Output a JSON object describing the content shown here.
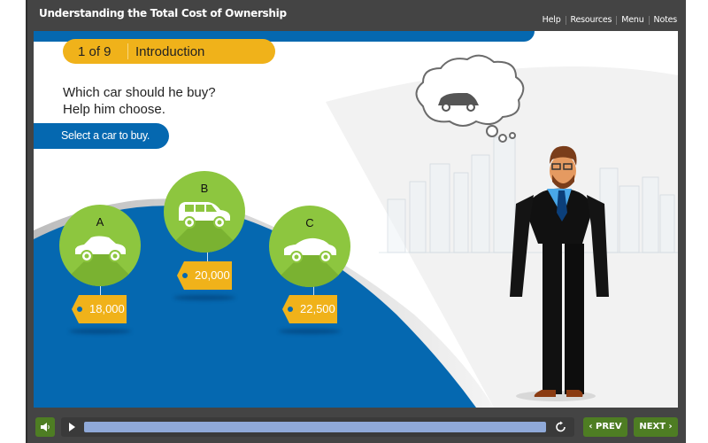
{
  "window": {
    "title": "Understanding the Total Cost of Ownership"
  },
  "top_links": [
    {
      "label": "Help"
    },
    {
      "label": "Resources"
    },
    {
      "label": "Menu"
    },
    {
      "label": "Notes"
    }
  ],
  "slide": {
    "progress_label": "1 of 9",
    "section": "Introduction",
    "question_line1": "Which car should he buy?",
    "question_line2": "Help him choose.",
    "instruction": "Select a car to buy.",
    "thought_bubble_icon": "suv-car-icon",
    "character": "businessman-illustration",
    "cars": [
      {
        "letter": "A",
        "type": "sedan",
        "icon": "sedan-car-icon",
        "price": "18,000"
      },
      {
        "letter": "B",
        "type": "suv",
        "icon": "suv-car-icon",
        "price": "20,000"
      },
      {
        "letter": "C",
        "type": "coupe",
        "icon": "coupe-car-icon",
        "price": "22,500"
      }
    ]
  },
  "controls": {
    "audio_icon": "speaker-icon",
    "play_icon": "play-icon",
    "replay_icon": "replay-icon",
    "progress": 1.0,
    "prev_label": "PREV",
    "next_label": "NEXT"
  },
  "colors": {
    "brand_blue": "#0568b0",
    "accent_yellow": "#f0b21a",
    "car_green": "#8dc63f",
    "button_green": "#4e7d23",
    "chrome_dark": "#444444"
  }
}
